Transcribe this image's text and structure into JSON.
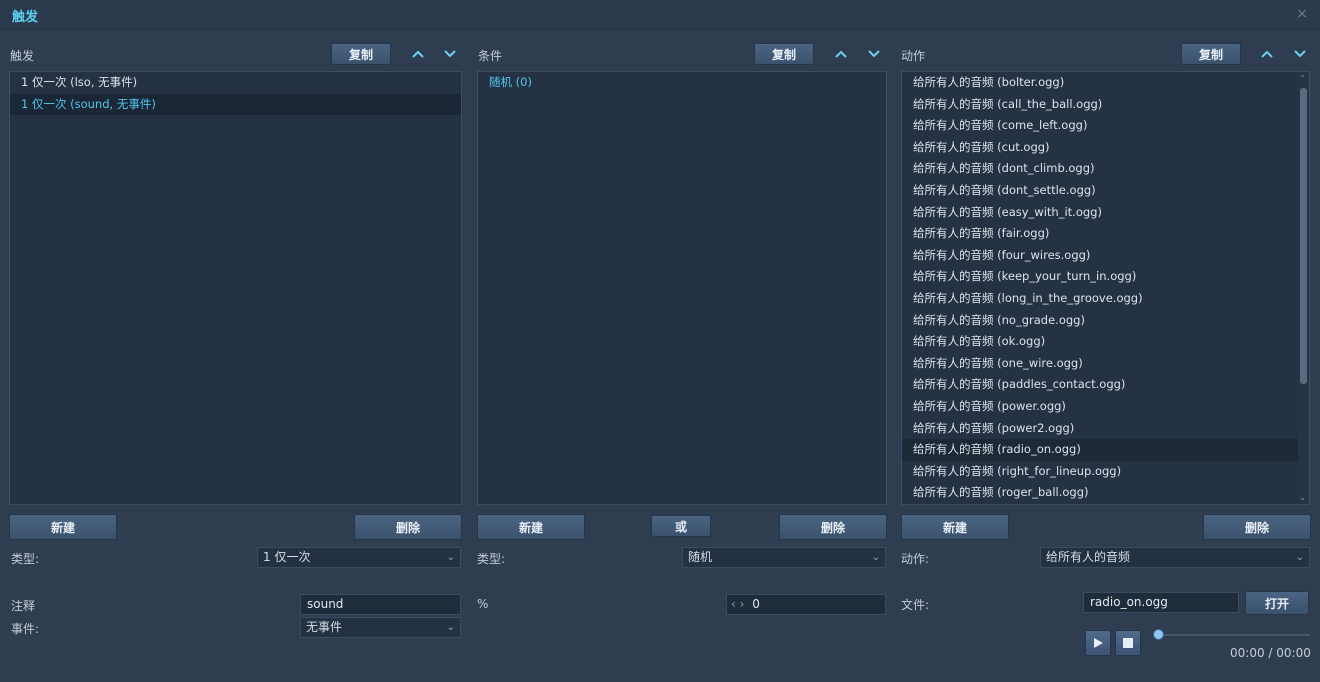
{
  "window": {
    "title": "触发",
    "close_glyph": "×"
  },
  "triggers": {
    "header": "触发",
    "copy_label": "复制",
    "items": [
      "1 仅一次 (lso, 无事件)",
      "1 仅一次 (sound, 无事件)"
    ],
    "selected_index": 1,
    "new_label": "新建",
    "delete_label": "删除",
    "type_label": "类型:",
    "type_value": "1 仅一次",
    "comment_label": "注释",
    "comment_value": "sound",
    "event_label": "事件:",
    "event_value": "无事件"
  },
  "conditions": {
    "header": "条件",
    "copy_label": "复制",
    "items": [
      "随机 (0)"
    ],
    "new_label": "新建",
    "or_label": "或",
    "delete_label": "删除",
    "type_label": "类型:",
    "type_value": "随机",
    "percent_label": "%",
    "spinner_value": "0"
  },
  "actions": {
    "header": "动作",
    "copy_label": "复制",
    "items": [
      "给所有人的音频 (bolter.ogg)",
      "给所有人的音频 (call_the_ball.ogg)",
      "给所有人的音频 (come_left.ogg)",
      "给所有人的音频 (cut.ogg)",
      "给所有人的音频 (dont_climb.ogg)",
      "给所有人的音频 (dont_settle.ogg)",
      "给所有人的音频 (easy_with_it.ogg)",
      "给所有人的音频 (fair.ogg)",
      "给所有人的音频 (four_wires.ogg)",
      "给所有人的音频 (keep_your_turn_in.ogg)",
      "给所有人的音频 (long_in_the_groove.ogg)",
      "给所有人的音频 (no_grade.ogg)",
      "给所有人的音频 (ok.ogg)",
      "给所有人的音频 (one_wire.ogg)",
      "给所有人的音频 (paddles_contact.ogg)",
      "给所有人的音频 (power.ogg)",
      "给所有人的音频 (power2.ogg)",
      "给所有人的音频 (radio_on.ogg)",
      "给所有人的音频 (right_for_lineup.ogg)",
      "给所有人的音频 (roger_ball.ogg)"
    ],
    "highlighted_index": 17,
    "new_label": "新建",
    "delete_label": "删除",
    "action_label": "动作:",
    "action_value": "给所有人的音频",
    "file_label": "文件:",
    "file_value": "radio_on.ogg",
    "open_label": "打开",
    "time_display": "00:00 / 00:00",
    "playback_progress": 0
  },
  "icons": {
    "up": "chevron-up-icon",
    "down": "chevron-down-icon",
    "play": "play-icon",
    "stop": "stop-icon",
    "close": "close-icon"
  },
  "colors": {
    "accent": "#5ed2f0",
    "background": "#2e3d50",
    "list_bg": "#243244",
    "button": "#4a6482"
  }
}
